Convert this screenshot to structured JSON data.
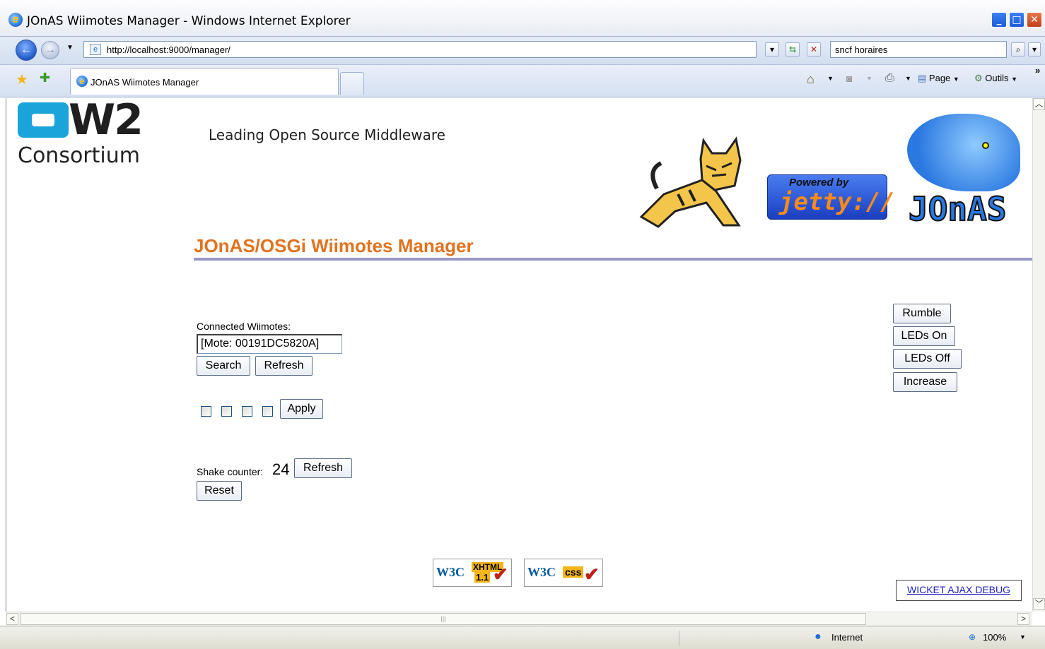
{
  "window": {
    "title": "JOnAS Wiimotes Manager - Windows Internet Explorer",
    "min_glyph": "_",
    "max_glyph": "□",
    "close_glyph": "✕"
  },
  "address_bar": {
    "url": "http://localhost:9000/manager/",
    "search_value": "sncf horaires"
  },
  "tabs": [
    {
      "label": "JOnAS Wiimotes Manager",
      "active": true
    }
  ],
  "command_bar": {
    "page_label": "Page",
    "tools_label": "Outils"
  },
  "page": {
    "logo_ow2": "OW2",
    "logo_consortium": "Consortium",
    "tagline": "Leading Open Source Middleware",
    "jetty_powered": "Powered by",
    "jetty_name": "jetty://",
    "jonas_logo_text": "JOnAS",
    "title": "JOnAS/OSGi Wiimotes Manager",
    "connected_label": "Connected Wiimotes:",
    "wiimote_value": "[Mote: 00191DC5820A]",
    "search_btn": "Search",
    "refresh_btn": "Refresh",
    "apply_btn": "Apply",
    "leds": [
      false,
      false,
      false,
      false
    ],
    "shake_label": "Shake counter:",
    "shake_count": "24",
    "shake_refresh_btn": "Refresh",
    "reset_btn": "Reset",
    "rumble_btn": "Rumble",
    "leds_on_btn": "LEDs On",
    "leds_off_btn": "LEDs Off",
    "increase_btn": "Increase",
    "w3c_xhtml_label": "XHTML",
    "w3c_xhtml_version": "1.1",
    "w3c_css_label": "css",
    "w3c_logo": "W3C",
    "debug_link": "WICKET AJAX DEBUG"
  },
  "status_bar": {
    "zone": "Internet",
    "zoom": "100%"
  },
  "colors": {
    "title_orange": "#e0731f",
    "ow2_blue": "#1aa4da",
    "jetty_blue": "#2a5ce0",
    "jonas_blue": "#3c8ef0"
  }
}
